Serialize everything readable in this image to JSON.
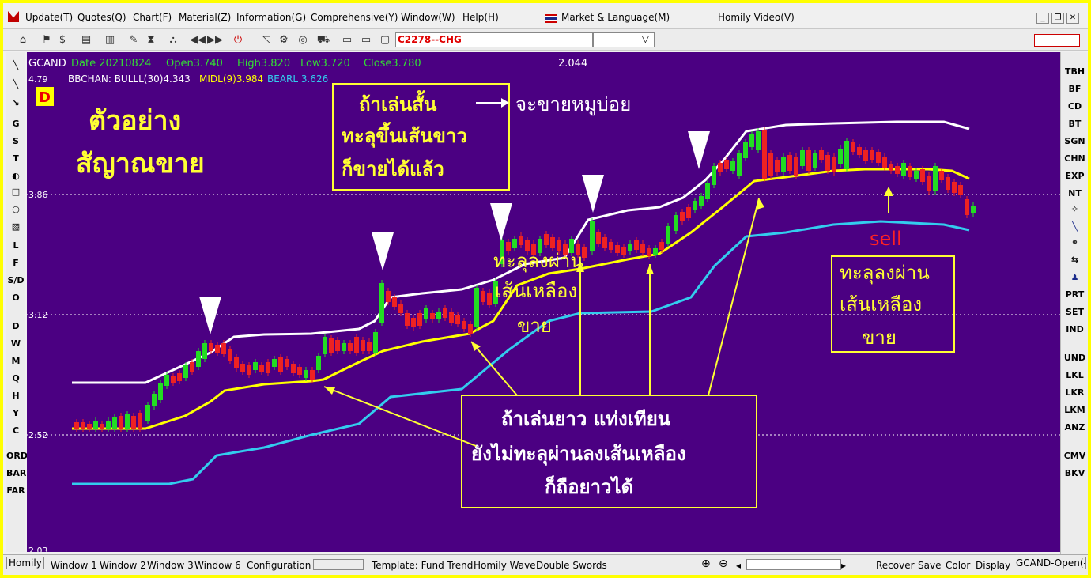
{
  "menu": {
    "items": [
      "Update(T)",
      "Quotes(Q)",
      "Chart(F)",
      "Material(Z)",
      "Information(G)",
      "Comprehensive(Y)",
      "Window(W)",
      "Help(H)"
    ],
    "market_language": "Market & Language(M)",
    "homily_video": "Homily Video(V)"
  },
  "toolbar": {
    "code_value": "C2278--CHG"
  },
  "left_tools": [
    "G",
    "S",
    "T",
    "L",
    "F",
    "S/D",
    "O",
    "D",
    "W",
    "M",
    "Q",
    "H",
    "Y",
    "C",
    "ORD",
    "BAR",
    "FAR"
  ],
  "right_tools": [
    "TBH",
    "BF",
    "CD",
    "BT",
    "SGN",
    "CHN",
    "EXP",
    "NT",
    "PRT",
    "SET",
    "IND",
    "UND",
    "LKL",
    "LKR",
    "LKM",
    "ANZ",
    "CMV",
    "BKV"
  ],
  "chart": {
    "symbol": "GCAND",
    "date": "Date 20210824",
    "open": "Open3.740",
    "high": "High3.820",
    "low": "Low3.720",
    "close": "Close3.780",
    "header_value": "2.044",
    "indicator_name": "BBCHAN: BULLL(30)4.343",
    "mid_label": "MIDL(9)3.984",
    "bear_label": "BEARL 3.626",
    "period_badge": "D",
    "price_labels": [
      "4.79",
      "3.86",
      "3.12",
      "2.52",
      "2.03"
    ]
  },
  "annotations": {
    "title_line1": "ตัวอย่าง",
    "title_line2": "สัญาณขาย",
    "box1_line1": "ถ้าเล่นสั้น",
    "box1_line2": "ทะลุขึ้นเส้นขาว",
    "box1_line3": "ก็ขายได้แล้ว",
    "arrow_text": "จะขายหมูบ่อย",
    "mid_text1": "ทะลุลงผ่าน",
    "mid_text2": "เส้นเหลือง",
    "mid_text3": "ขาย",
    "box2_line1": "ถ้าเล่นยาว แท่งเทียน",
    "box2_line2": "ยังไม่ทะลุผ่านลงเส้นเหลือง",
    "box2_line3": "ก็ถือยาวได้",
    "sell_text": "sell",
    "box3_line1": "ทะลุลงผ่าน",
    "box3_line2": "เส้นเหลือง",
    "box3_line3": "ขาย"
  },
  "bottom": {
    "status_left": "Homily",
    "windows": [
      "Window 1",
      "Window 2",
      "Window 3",
      "Window 6"
    ],
    "configuration": "Configuration",
    "template": "Template: Fund Trend",
    "template_items": [
      "Homily Wave",
      "Double Swords"
    ],
    "actions": [
      "Recover",
      "Save",
      "Color",
      "Display"
    ],
    "status_right": "GCAND-Open(-"
  },
  "colors": {
    "chart_bg": "#4b0082",
    "upper_band": "#ffffff",
    "mid_band": "#ffff00",
    "lower_band": "#33ccee",
    "up_candle": "#22dd22",
    "down_candle": "#ee2222",
    "annotation": "#ffff33",
    "sell": "#ff2222"
  }
}
